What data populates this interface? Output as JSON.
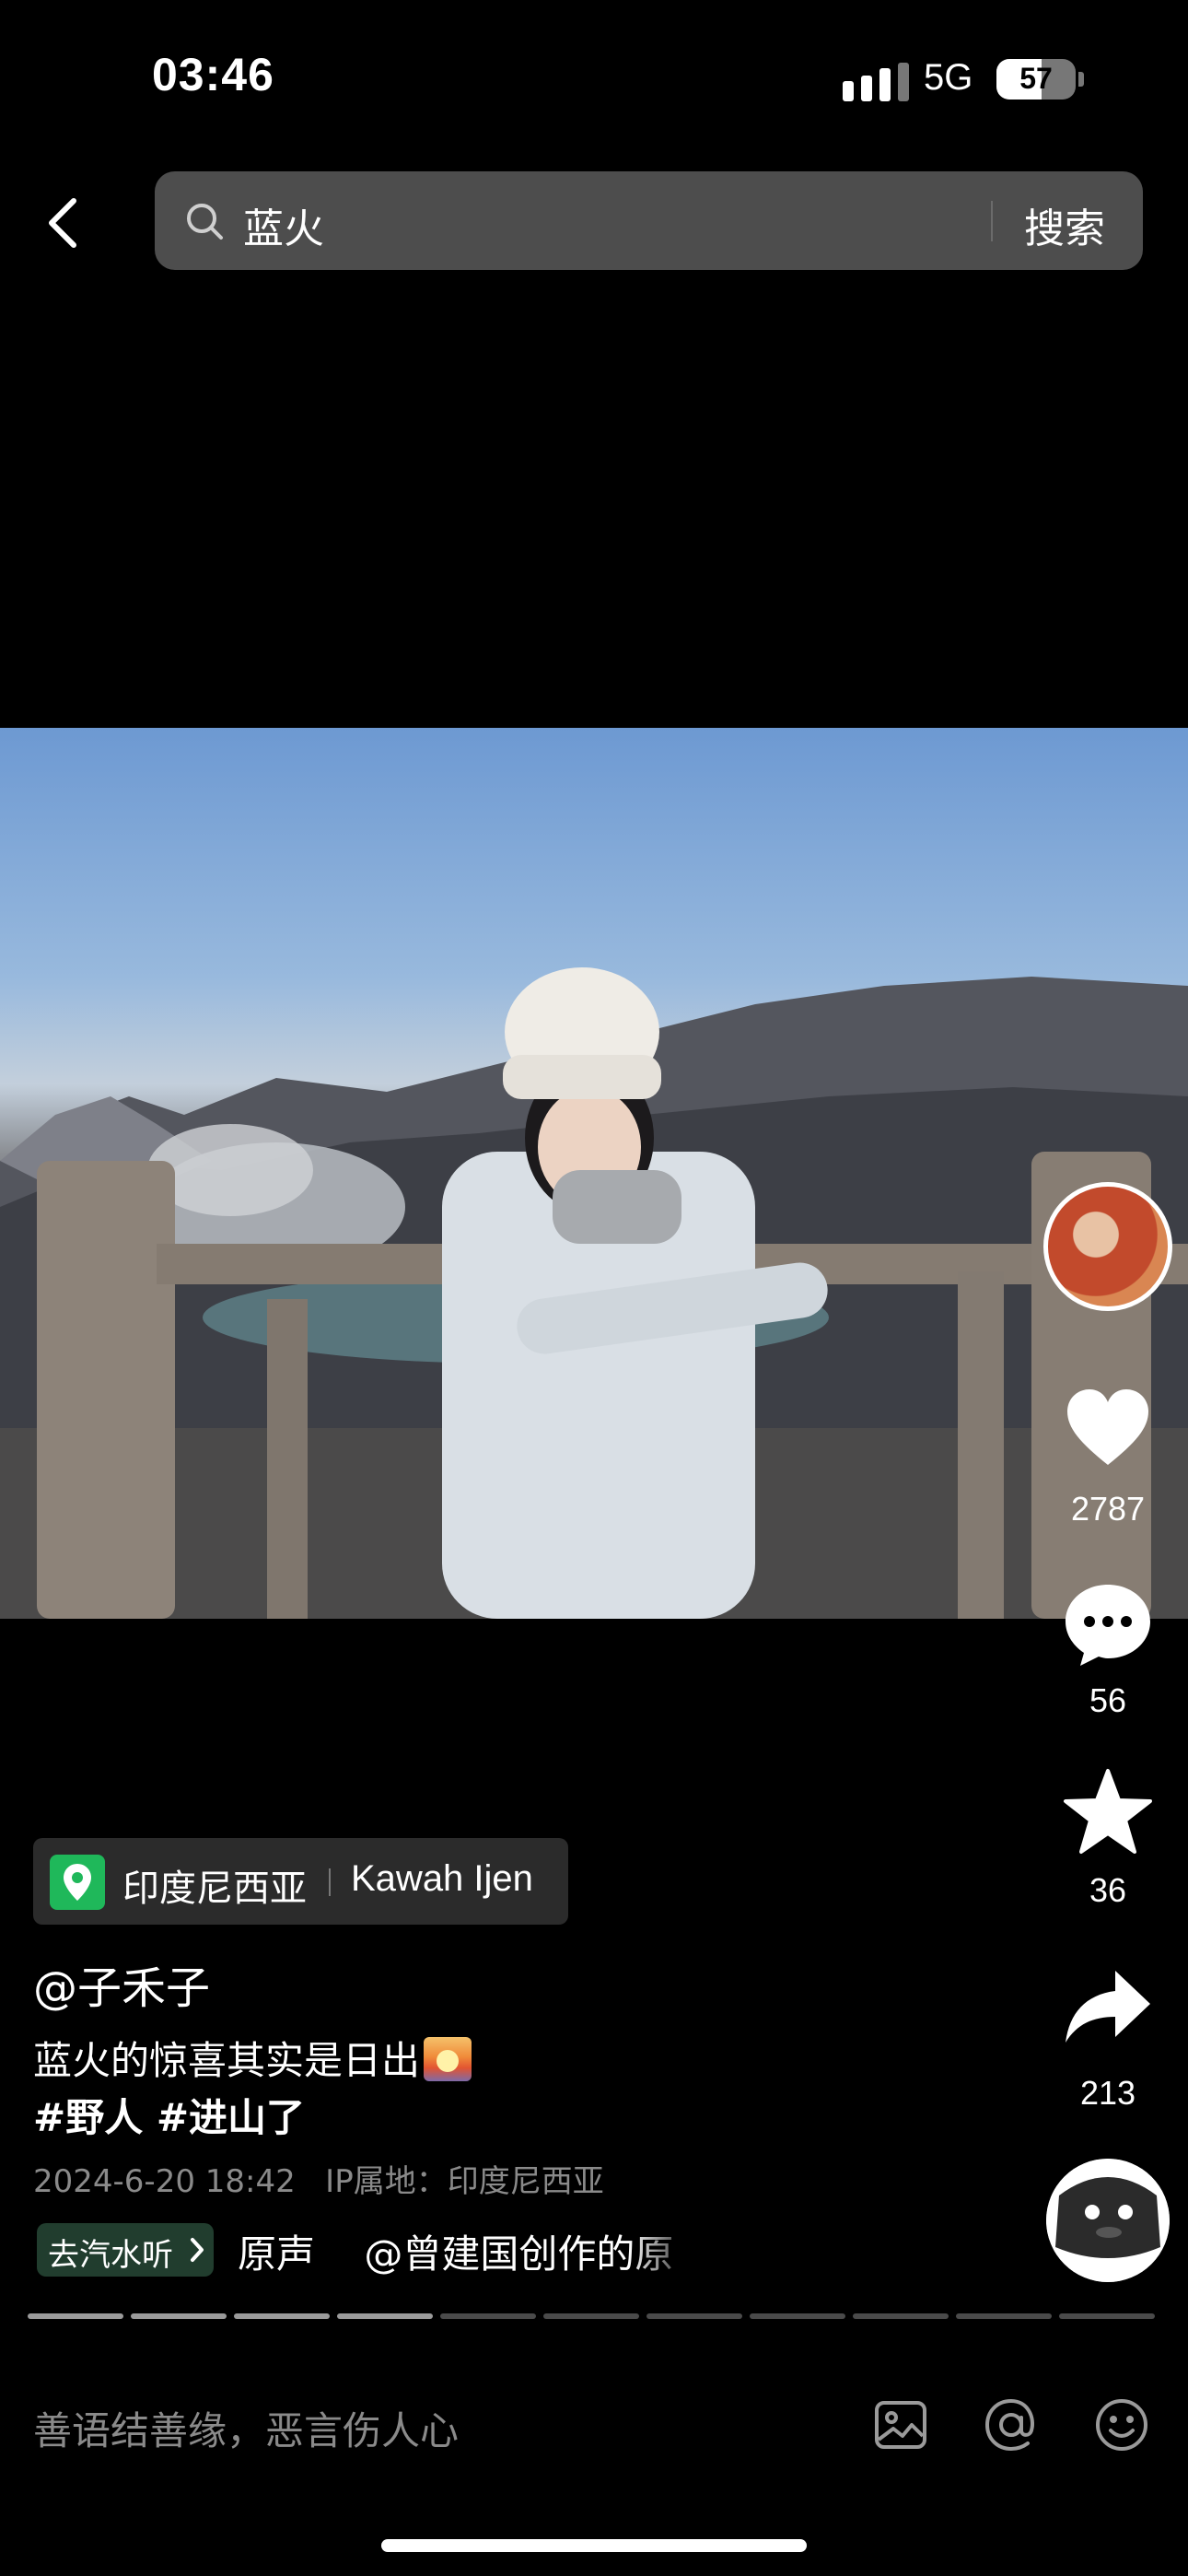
{
  "status_bar": {
    "time": "03:46",
    "network": "5G",
    "battery": "57",
    "battery_level_percent": 57
  },
  "search": {
    "query": "蓝火",
    "button_label": "搜索"
  },
  "actions": {
    "like_count": "2787",
    "comment_count": "56",
    "favorite_count": "36",
    "share_count": "213"
  },
  "post": {
    "location_country": "印度尼西亚",
    "location_place": "Kawah Ijen",
    "author": "@子禾子",
    "caption": "蓝火的惊喜其实是日出",
    "hashtags": "#野人 #进山了",
    "meta": "2024-6-20 18:42   IP属地：印度尼西亚",
    "music_tag": "去汽水听",
    "music_text": "原声    @曾建国创作的原"
  },
  "progress": {
    "total_segments": 11,
    "completed_segments": 4
  },
  "comment_bar": {
    "placeholder": "善语结善缘，恶言伤人心"
  },
  "icons": {
    "back": "chevron-left-icon",
    "search": "search-icon",
    "like": "heart-icon",
    "comment": "comment-icon",
    "favorite": "star-icon",
    "share": "share-icon",
    "image": "image-icon",
    "mention": "at-icon",
    "emoji": "emoji-icon",
    "location": "location-pin-icon"
  }
}
